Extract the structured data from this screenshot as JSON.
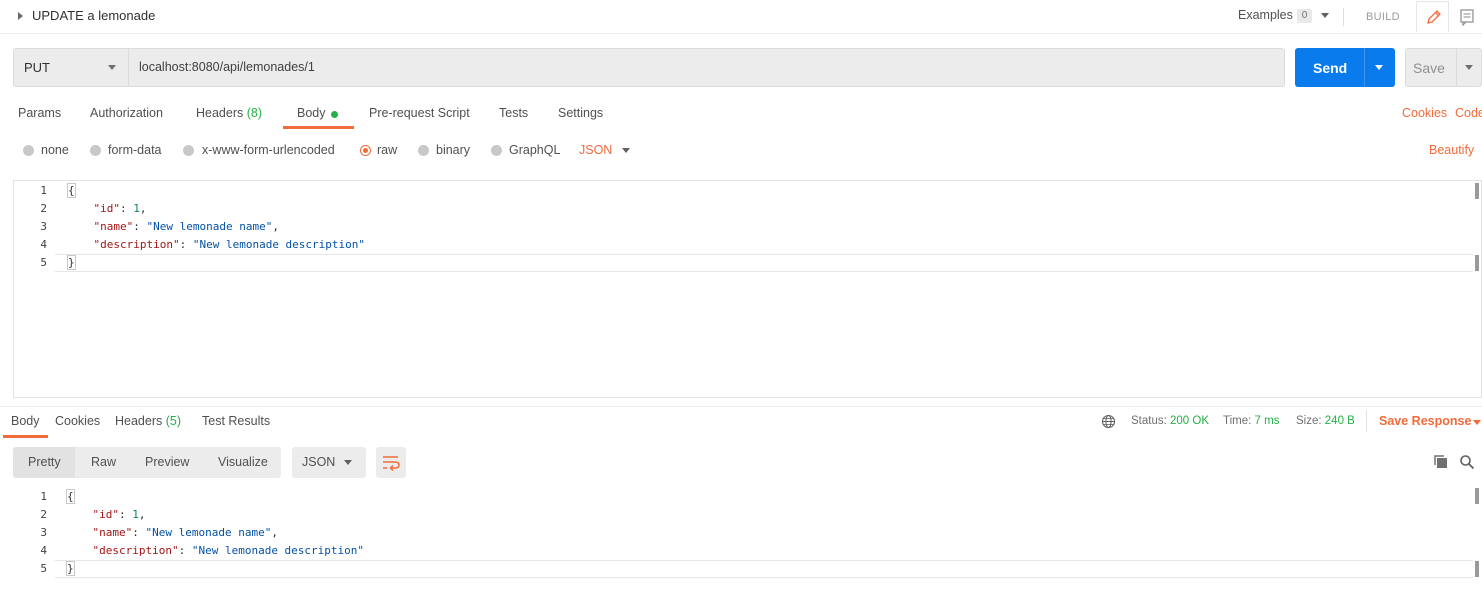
{
  "request": {
    "name": "UPDATE a lemonade",
    "examples_label": "Examples",
    "examples_count": "0",
    "build_label": "BUILD",
    "method": "PUT",
    "url": "localhost:8080/api/lemonades/1",
    "send_label": "Send",
    "save_label": "Save"
  },
  "request_tabs": {
    "params": "Params",
    "authorization": "Authorization",
    "headers": "Headers",
    "headers_count": "(8)",
    "body": "Body",
    "pre_request_script": "Pre-request Script",
    "tests": "Tests",
    "settings": "Settings",
    "cookies": "Cookies",
    "code": "Code"
  },
  "body_types": {
    "none": "none",
    "form_data": "form-data",
    "urlencoded": "x-www-form-urlencoded",
    "raw": "raw",
    "binary": "binary",
    "graphql": "GraphQL",
    "language": "JSON",
    "beautify": "Beautify",
    "selected": "raw"
  },
  "request_body": {
    "line_numbers": [
      "1",
      "2",
      "3",
      "4",
      "5"
    ],
    "open_brace": "{",
    "id_key": "\"id\"",
    "id_value": "1",
    "name_key": "\"name\"",
    "name_value": "\"New lemonade name\"",
    "desc_key": "\"description\"",
    "desc_value": "\"New lemonade description\"",
    "close_brace": "}"
  },
  "response_tabs": {
    "body": "Body",
    "cookies": "Cookies",
    "headers": "Headers",
    "headers_count": "(5)",
    "test_results": "Test Results"
  },
  "response_meta": {
    "status_label": "Status:",
    "status_value": "200 OK",
    "time_label": "Time:",
    "time_value": "7 ms",
    "size_label": "Size:",
    "size_value": "240 B",
    "save_response": "Save Response"
  },
  "response_format": {
    "pretty": "Pretty",
    "raw": "Raw",
    "preview": "Preview",
    "visualize": "Visualize",
    "language": "JSON"
  },
  "response_body": {
    "line_numbers": [
      "1",
      "2",
      "3",
      "4",
      "5"
    ],
    "open_brace": "{",
    "id_key": "\"id\"",
    "id_value": "1",
    "name_key": "\"name\"",
    "name_value": "\"New lemonade name\"",
    "desc_key": "\"description\"",
    "desc_value": "\"New lemonade description\"",
    "close_brace": "}"
  },
  "colors": {
    "accent": "#f26b3a",
    "send": "#097bed",
    "success": "#26b047"
  },
  "icons": [
    "caret-right-icon",
    "pencil-icon",
    "document-icon",
    "globe-icon",
    "wrap-lines-icon",
    "copy-icon",
    "search-icon"
  ]
}
